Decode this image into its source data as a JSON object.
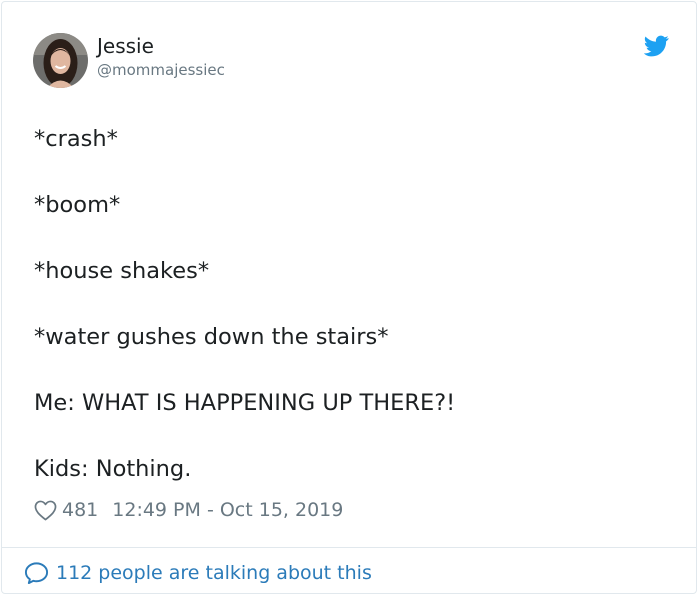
{
  "author": {
    "name": "Jessie",
    "handle": "@mommajessiec"
  },
  "icons": {
    "avatar": "avatar-photo",
    "brand": "twitter-bird-icon",
    "like": "heart-icon",
    "reply": "speech-bubble-icon"
  },
  "colors": {
    "brand_blue": "#1da1f2",
    "link_blue": "#2b7bb9",
    "muted_gray": "#697882",
    "text": "#1c2022"
  },
  "tweet": {
    "lines": [
      "*crash*",
      "*boom*",
      "*house shakes*",
      "*water gushes down the stairs*",
      "Me: WHAT IS HAPPENING UP THERE?!",
      "Kids: Nothing."
    ]
  },
  "meta": {
    "likes": "481",
    "timestamp": "12:49 PM - Oct 15, 2019"
  },
  "footer": {
    "talking_text": "112 people are talking about this"
  }
}
